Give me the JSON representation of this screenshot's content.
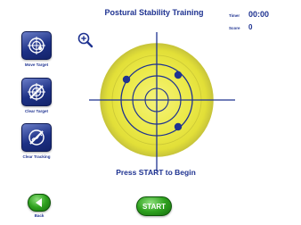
{
  "title": "Postural Stability Training",
  "stats": {
    "timer_label": "Timer",
    "timer_value": "00:00",
    "score_label": "Score",
    "score_value": "0"
  },
  "tools": [
    {
      "label": "Move Target",
      "icon": "move-target-icon"
    },
    {
      "label": "Clear Target",
      "icon": "clear-target-icon"
    },
    {
      "label": "Clear Tracking",
      "icon": "clear-tracking-icon"
    }
  ],
  "zoom_icon": "zoom-in-icon",
  "prompt": "Press START to Begin",
  "start_label": "START",
  "back_label": "Back",
  "target_markers": 3,
  "colors": {
    "title_blue": "#1f3391",
    "board_yellow": "#e9e73c",
    "board_rim": "#c9c63a",
    "button_navy": "#1d3186",
    "button_green": "#2fa21f"
  }
}
